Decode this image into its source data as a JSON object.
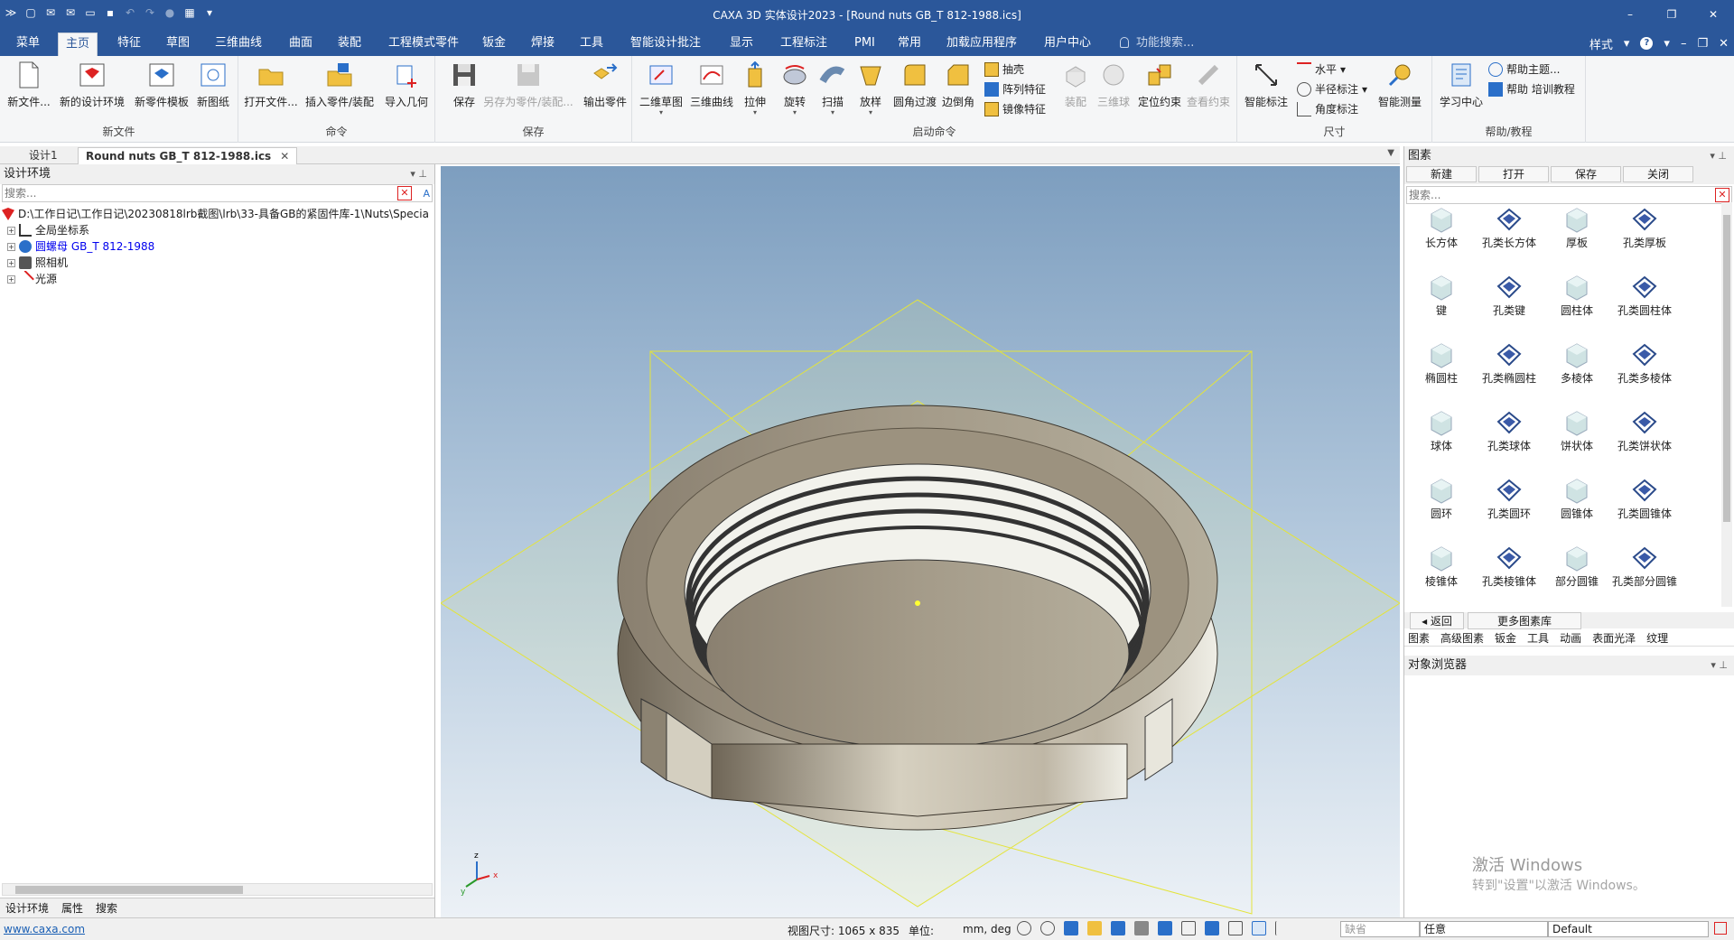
{
  "window": {
    "title": "CAXA 3D 实体设计2023 - [Round nuts GB_T 812-1988.ics]"
  },
  "menu_tabs": [
    "菜单",
    "主页",
    "特征",
    "草图",
    "三维曲线",
    "曲面",
    "装配",
    "工程模式零件",
    "钣金",
    "焊接",
    "工具",
    "智能设计批注",
    "显示",
    "工程标注",
    "PMI",
    "常用",
    "加载应用程序",
    "用户中心"
  ],
  "function_search": "功能搜索...",
  "right_menu": {
    "style": "样式"
  },
  "ribbon": {
    "groups": {
      "new_file": "新文件",
      "command": "命令",
      "save": "保存",
      "launch": "启动命令",
      "dimension": "尺寸",
      "help": "帮助/教程"
    },
    "buttons": {
      "new_file": "新文件...",
      "new_env": "新的设计环境",
      "new_part_template": "新零件模板",
      "new_drawing": "新图纸",
      "open_file": "打开文件...",
      "insert_part": "插入零件/装配",
      "import_geo": "导入几何",
      "save": "保存",
      "save_as_part": "另存为零件/装配...",
      "export_part": "输出零件",
      "sketch2d": "二维草图",
      "curve3d": "三维曲线",
      "extrude": "拉伸",
      "revolve": "旋转",
      "sweep": "扫描",
      "loft": "放样",
      "fillet": "圆角过渡",
      "chamfer": "边倒角",
      "shell": "抽壳",
      "array": "阵列特征",
      "mirror": "镜像特征",
      "assembly": "装配",
      "ball3d": "三维球",
      "locate": "定位约束",
      "view_constraint": "查看约束",
      "smart_dim": "智能标注",
      "horizontal": "水平",
      "radius": "半径标注",
      "angle": "角度标注",
      "smart_measure": "智能测量",
      "learn": "学习中心",
      "help_topic": "帮助主题...",
      "help_training": "帮助 培训教程"
    }
  },
  "doc_tabs": [
    "设计1",
    "Round nuts GB_T 812-1988.ics"
  ],
  "left_panel": {
    "title": "设计环境",
    "search_placeholder": "搜索...",
    "tree": [
      {
        "label": "D:\\工作日记\\工作日记\\20230818lrb截图\\lrb\\33-具备GB的紧固件库-1\\Nuts\\Specia",
        "color": "#1a1a1a"
      },
      {
        "label": "全局坐标系",
        "color": "#1a1a1a"
      },
      {
        "label": "圆螺母 GB_T 812-1988",
        "color": "#0000ee"
      },
      {
        "label": "照相机",
        "color": "#1a1a1a"
      },
      {
        "label": "光源",
        "color": "#1a1a1a"
      }
    ],
    "bottom_tabs": [
      "设计环境",
      "属性",
      "搜索"
    ]
  },
  "right_panel": {
    "title": "图素",
    "toolbar": [
      "新建",
      "打开",
      "保存",
      "关闭"
    ],
    "search_placeholder": "搜索...",
    "library_items": [
      "长方体",
      "孔类长方体",
      "厚板",
      "孔类厚板",
      "键",
      "孔类键",
      "圆柱体",
      "孔类圆柱体",
      "椭圆柱",
      "孔类椭圆柱",
      "多棱体",
      "孔类多棱体",
      "球体",
      "孔类球体",
      "饼状体",
      "孔类饼状体",
      "圆环",
      "孔类圆环",
      "圆锥体",
      "孔类圆锥体",
      "棱锥体",
      "孔类棱锥体",
      "部分圆锥",
      "孔类部分圆锥"
    ],
    "back": "返回",
    "more": "更多图素库",
    "tabs": [
      "图素",
      "高级图素",
      "钣金",
      "工具",
      "动画",
      "表面光泽",
      "纹理"
    ],
    "object_browser": "对象浏览器"
  },
  "watermark": {
    "line1": "激活 Windows",
    "line2": "转到\"设置\"以激活 Windows。"
  },
  "statusbar": {
    "link": "www.caxa.com",
    "viewsize": "视图尺寸: 1065 x  835",
    "unit_label": "单位:",
    "unit_value": "mm, deg",
    "select1": "缺省",
    "select2": "任意",
    "select3": "Default"
  },
  "colors": {
    "title_bar": "#2b579a",
    "accent": "#2b579a"
  }
}
